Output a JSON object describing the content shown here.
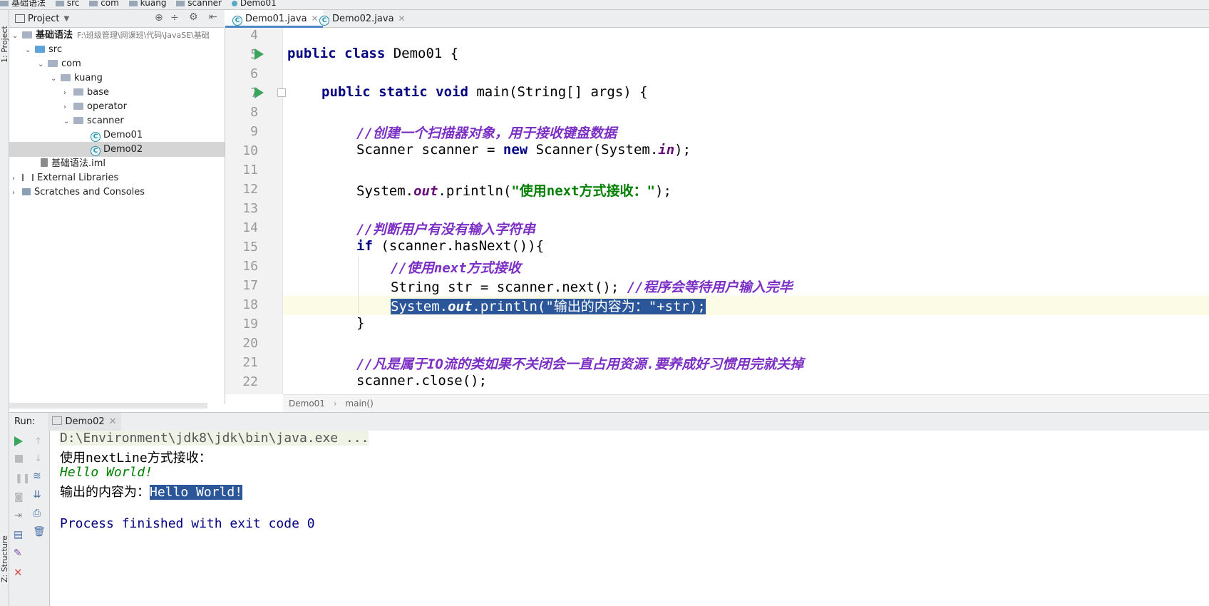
{
  "breadcrumb": [
    "基础语法",
    "src",
    "com",
    "kuang",
    "scanner",
    "Demo01"
  ],
  "side_tabs": {
    "project": "1: Project",
    "structure": "Z: Structure"
  },
  "project_panel": {
    "title": "Project"
  },
  "tree": [
    {
      "label": "基础语法",
      "path": "F:\\班级管理\\网课班\\代码\\JavaSE\\基础",
      "icon": "folder-icon",
      "arrow": "v"
    },
    {
      "label": "src",
      "icon": "source-folder-icon",
      "arrow": "v"
    },
    {
      "label": "com",
      "icon": "package-icon",
      "arrow": "v"
    },
    {
      "label": "kuang",
      "icon": "package-icon",
      "arrow": "v"
    },
    {
      "label": "base",
      "icon": "package-icon",
      "arrow": ">"
    },
    {
      "label": "operator",
      "icon": "package-icon",
      "arrow": ">"
    },
    {
      "label": "scanner",
      "icon": "package-icon",
      "arrow": "v"
    },
    {
      "label": "Demo01",
      "icon": "java-class-icon",
      "arrow": ""
    },
    {
      "label": "Demo02",
      "icon": "java-class-icon",
      "arrow": "",
      "selected": true
    },
    {
      "label": "基础语法.iml",
      "icon": "iml-file-icon",
      "arrow": ""
    },
    {
      "label": "External Libraries",
      "icon": "library-icon",
      "arrow": ">"
    },
    {
      "label": "Scratches and Consoles",
      "icon": "scratches-icon",
      "arrow": ">"
    }
  ],
  "tabs": [
    {
      "label": "Demo01.java",
      "active": true
    },
    {
      "label": "Demo02.java",
      "active": false
    }
  ],
  "line_numbers": [
    "4",
    "5",
    "6",
    "7",
    "8",
    "9",
    "10",
    "11",
    "12",
    "13",
    "14",
    "15",
    "16",
    "17",
    "18",
    "19",
    "20",
    "21",
    "22"
  ],
  "code": {
    "l5": {
      "kw": "public class",
      "rest": " Demo01 {"
    },
    "l7": {
      "kw": "public static void",
      "rest": " main(String[] args) {"
    },
    "l9": "//创建一个扫描器对象，用于接收键盘数据",
    "l10": {
      "a": "Scanner scanner = ",
      "kw": "new",
      "b": " Scanner(System.",
      "fld": "in",
      "c": ");"
    },
    "l12": {
      "a": "System.",
      "fld": "out",
      "b": ".println(",
      "str": "\"使用next方式接收：\"",
      "c": ");"
    },
    "l14": "//判断用户有没有输入字符串",
    "l15": {
      "kw": "if",
      "rest": " (scanner.hasNext()){"
    },
    "l16": "//使用next方式接收",
    "l17": {
      "a": "String str = scanner.next(); ",
      "cm": "//程序会等待用户输入完毕"
    },
    "l18": {
      "a": "System.",
      "fld": "out",
      "b": ".println(\"输出的内容为：\"+str);"
    },
    "l19": "}",
    "l21": "//凡是属于IO流的类如果不关闭会一直占用资源.要养成好习惯用完就关掉",
    "l22": "scanner.close();"
  },
  "editor_breadcrumb": {
    "cls": "Demo01",
    "method": "main()"
  },
  "run": {
    "label": "Run:",
    "tab": "Demo02"
  },
  "console": {
    "cmd": "D:\\Environment\\jdk8\\jdk\\bin\\java.exe ...",
    "l1": "使用nextLine方式接收：",
    "l2": "Hello World!",
    "l3_prefix": "输出的内容为：",
    "l3_value": "Hello World!",
    "l5": "Process finished with exit code 0"
  },
  "colors": {
    "keyword": "#000080",
    "comment": "#7b2fc4",
    "string": "#008000",
    "selection": "#2b579a",
    "run_green": "#3aa55d"
  }
}
